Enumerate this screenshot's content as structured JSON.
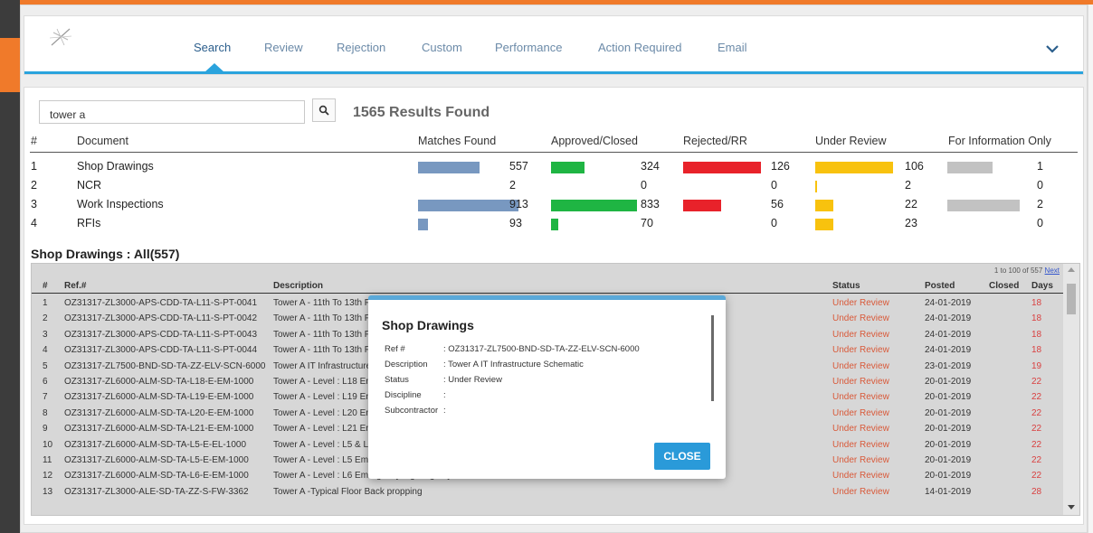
{
  "nav": {
    "items": [
      "Search",
      "Review",
      "Rejection",
      "Custom",
      "Performance",
      "Action Required",
      "Email"
    ],
    "active_index": 0
  },
  "search": {
    "value": "tower a",
    "results_count": "1565 Results Found"
  },
  "summary": {
    "headers": [
      "#",
      "Document",
      "Matches Found",
      "Approved/Closed",
      "Rejected/RR",
      "Under Review",
      "For Information Only"
    ],
    "rows": [
      {
        "num": "1",
        "document": "Shop Drawings",
        "matches": "557",
        "approved": "324",
        "rejected": "126",
        "under_review": "106",
        "info_only": "1",
        "bars": {
          "matches": 0.61,
          "approved": 0.39,
          "rejected": 0.9,
          "under_review": 0.86,
          "info_only": 0.62
        }
      },
      {
        "num": "2",
        "document": "NCR",
        "matches": "2",
        "approved": "0",
        "rejected": "0",
        "under_review": "2",
        "info_only": "0",
        "bars": {
          "matches": 0,
          "approved": 0,
          "rejected": 0,
          "under_review": 0.02,
          "info_only": 0
        }
      },
      {
        "num": "3",
        "document": "Work Inspections",
        "matches": "913",
        "approved": "833",
        "rejected": "56",
        "under_review": "22",
        "info_only": "2",
        "bars": {
          "matches": 1.0,
          "approved": 1.0,
          "rejected": 0.44,
          "under_review": 0.2,
          "info_only": 1.0
        }
      },
      {
        "num": "4",
        "document": "RFIs",
        "matches": "93",
        "approved": "70",
        "rejected": "0",
        "under_review": "23",
        "info_only": "0",
        "bars": {
          "matches": 0.1,
          "approved": 0.08,
          "rejected": 0,
          "under_review": 0.2,
          "info_only": 0
        }
      }
    ],
    "colors": {
      "matches": "#7898c0",
      "approved": "#1fb543",
      "rejected": "#e8222a",
      "under_review": "#f8c20e",
      "info_only": "#c2c2c2"
    }
  },
  "section_title": "Shop Drawings : All(557)",
  "grid": {
    "pager": "1 to 100 of 557",
    "next_label": "Next",
    "headers": [
      "#",
      "Ref.#",
      "Description",
      "Status",
      "Posted",
      "Closed",
      "Days"
    ],
    "rows": [
      {
        "n": "1",
        "ref": "OZ31317-ZL3000-APS-CDD-TA-L11-S-PT-0041",
        "desc": "Tower A - 11th To 13th Flo",
        "status": "Under Review",
        "posted": "24-01-2019",
        "closed": "",
        "days": "18"
      },
      {
        "n": "2",
        "ref": "OZ31317-ZL3000-APS-CDD-TA-L11-S-PT-0042",
        "desc": "Tower A - 11th To 13th Flo",
        "status": "Under Review",
        "posted": "24-01-2019",
        "closed": "",
        "days": "18"
      },
      {
        "n": "3",
        "ref": "OZ31317-ZL3000-APS-CDD-TA-L11-S-PT-0043",
        "desc": "Tower A - 11th To 13th Flo",
        "status": "Under Review",
        "posted": "24-01-2019",
        "closed": "",
        "days": "18"
      },
      {
        "n": "4",
        "ref": "OZ31317-ZL3000-APS-CDD-TA-L11-S-PT-0044",
        "desc": "Tower A - 11th To 13th Flo",
        "status": "Under Review",
        "posted": "24-01-2019",
        "closed": "",
        "days": "18"
      },
      {
        "n": "5",
        "ref": "OZ31317-ZL7500-BND-SD-TA-ZZ-ELV-SCN-6000",
        "desc": "Tower A IT Infrastructure",
        "status": "Under Review",
        "posted": "23-01-2019",
        "closed": "",
        "days": "19"
      },
      {
        "n": "6",
        "ref": "OZ31317-ZL6000-ALM-SD-TA-L18-E-EM-1000",
        "desc": "Tower A - Level : L18 Em",
        "status": "Under Review",
        "posted": "20-01-2019",
        "closed": "",
        "days": "22"
      },
      {
        "n": "7",
        "ref": "OZ31317-ZL6000-ALM-SD-TA-L19-E-EM-1000",
        "desc": "Tower A - Level : L19 Em",
        "status": "Under Review",
        "posted": "20-01-2019",
        "closed": "",
        "days": "22"
      },
      {
        "n": "8",
        "ref": "OZ31317-ZL6000-ALM-SD-TA-L20-E-EM-1000",
        "desc": "Tower A - Level : L20 Em",
        "status": "Under Review",
        "posted": "20-01-2019",
        "closed": "",
        "days": "22"
      },
      {
        "n": "9",
        "ref": "OZ31317-ZL6000-ALM-SD-TA-L21-E-EM-1000",
        "desc": "Tower A - Level : L21 Em",
        "status": "Under Review",
        "posted": "20-01-2019",
        "closed": "",
        "days": "22"
      },
      {
        "n": "10",
        "ref": "OZ31317-ZL6000-ALM-SD-TA-L5-E-EL-1000",
        "desc": "Tower A - Level : L5 & Lo",
        "status": "Under Review",
        "posted": "20-01-2019",
        "closed": "",
        "days": "22"
      },
      {
        "n": "11",
        "ref": "OZ31317-ZL6000-ALM-SD-TA-L5-E-EM-1000",
        "desc": "Tower A - Level : L5 Eme",
        "status": "Under Review",
        "posted": "20-01-2019",
        "closed": "",
        "days": "22"
      },
      {
        "n": "12",
        "ref": "OZ31317-ZL6000-ALM-SD-TA-L6-E-EM-1000",
        "desc": "Tower A - Level : L6 Emergency Lighting Layout",
        "status": "Under Review",
        "posted": "20-01-2019",
        "closed": "",
        "days": "22"
      },
      {
        "n": "13",
        "ref": "OZ31317-ZL3000-ALE-SD-TA-ZZ-S-FW-3362",
        "desc": "Tower A -Typical Floor Back propping",
        "status": "Under Review",
        "posted": "14-01-2019",
        "closed": "",
        "days": "28"
      }
    ]
  },
  "modal": {
    "title": "Shop Drawings",
    "fields": [
      {
        "label": "Ref #",
        "value": ": OZ31317-ZL7500-BND-SD-TA-ZZ-ELV-SCN-6000"
      },
      {
        "label": "Description",
        "value": ": Tower A IT Infrastructure Schematic"
      },
      {
        "label": "Status",
        "value": ": Under Review"
      },
      {
        "label": "Discipline",
        "value": ":"
      },
      {
        "label": "Subcontractor",
        "value": ":"
      }
    ],
    "close_label": "CLOSE"
  },
  "icons": {
    "logo": "logo-icon",
    "search": "search-icon",
    "dropdown": "chevron-down-icon"
  },
  "colors": {
    "accent_orange": "#f07a2a",
    "accent_blue": "#2aa3dd",
    "status_text": "#d95a3a"
  }
}
